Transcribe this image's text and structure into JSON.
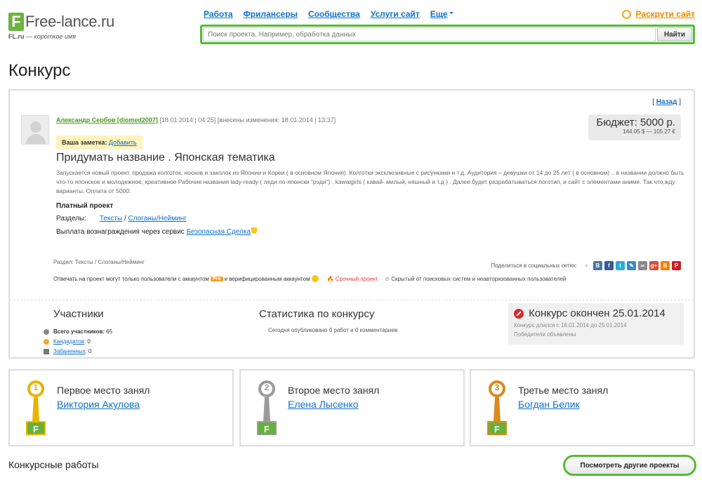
{
  "header": {
    "logo_letter": "F",
    "logo_text": "Free-lance.ru",
    "logo_sub_bold": "FL.ru",
    "logo_sub_rest": " — короткое имя",
    "nav": [
      "Работа",
      "Фрилансеры",
      "Сообщества",
      "Услуги сайт",
      "Еще"
    ],
    "promote": "Раскрути сайт",
    "search_placeholder": "Поиск проекта. Например, обработка данных",
    "search_button": "Найти"
  },
  "page_title": "Конкурс",
  "project": {
    "back_link": "Назад",
    "author": "Александр Сербов [diomed2007]",
    "dates": " [18.01.2014 | 04:25] [внесены изменения: 18.01.2014 | 13:37]",
    "budget": "Бюджет: 5000 р.",
    "budget_sub": "144.05 $ — 105.27 €",
    "note_label": "Ваша заметка: ",
    "note_link": "Добавить",
    "title": "Придумать название . Японская тематика",
    "description": "Запускается новый проект. продажа колготок, носков и заколок из Японии и Кореи ( в основном Япония). Колготки эксклюзивные с рисунками и т.д. Аудитория – девушки от 14 до 25 лет ( в основном) .. в названии должно быть что-то японское и молодежное, креативное Рабочие названия lady-ready ( леди по-японски \"рэди\") , kawaigirls ( кавай- милый, няшный и т.д ) . Далее будет разрабатываться логотип, и сайт с элементами аниме. Так что,жду варианты. Оплата от 5000.",
    "paid_label": "Платный проект",
    "sections_label": "Разделы:",
    "section_link_1": "Тексты",
    "section_sep": " / ",
    "section_link_2": "Слоганы/Нейминг",
    "payout_text": "Выплата вознаграждения через сервис ",
    "payout_link": "Безопасная Сделка",
    "section_foot": "Раздел: Тексты / Слоганы/Нейминг",
    "share_label": "Поделиться в социальных сетях:",
    "restrict_1": "Отвечать на проект могут только пользователи с аккаунтом",
    "pro_badge": "Pro",
    "restrict_2": "и верифицированным аккаунтом",
    "urgent": "Срочный проект",
    "hidden": "Скрытый от поисковых систем и неавторизованных пользователей"
  },
  "stats": {
    "participants_title": "Участники",
    "total_label": "Всего участников:",
    "total_value": "65",
    "candidates_label": "Кандидатов",
    "candidates_value": ": 0",
    "banned_label": "Забаненных",
    "banned_value": ": 0",
    "contest_stats_title": "Статистика по конкурсу",
    "contest_stats_text": "Сегодня опубликовано 0 работ и 0 комментариев",
    "ended_title": "Конкурс окончен 25.01.2014",
    "ended_duration": "Конкурс длился с 18.01.2014 до 25.01.2014",
    "ended_winners": "Победители объявлены"
  },
  "winners": [
    {
      "place": "Первое место занял",
      "name": "Виктория Акулова",
      "num": "1",
      "color": "#e8b400"
    },
    {
      "place": "Второе место занял",
      "name": "Елена Лысенко",
      "num": "2",
      "color": "#9a9a9a"
    },
    {
      "place": "Третье место занял",
      "name": "Богдан Белик",
      "num": "3",
      "color": "#d98a1e"
    }
  ],
  "footer": {
    "works_title": "Конкурсные работы",
    "other_button": "Посмотреть другие проекты"
  }
}
